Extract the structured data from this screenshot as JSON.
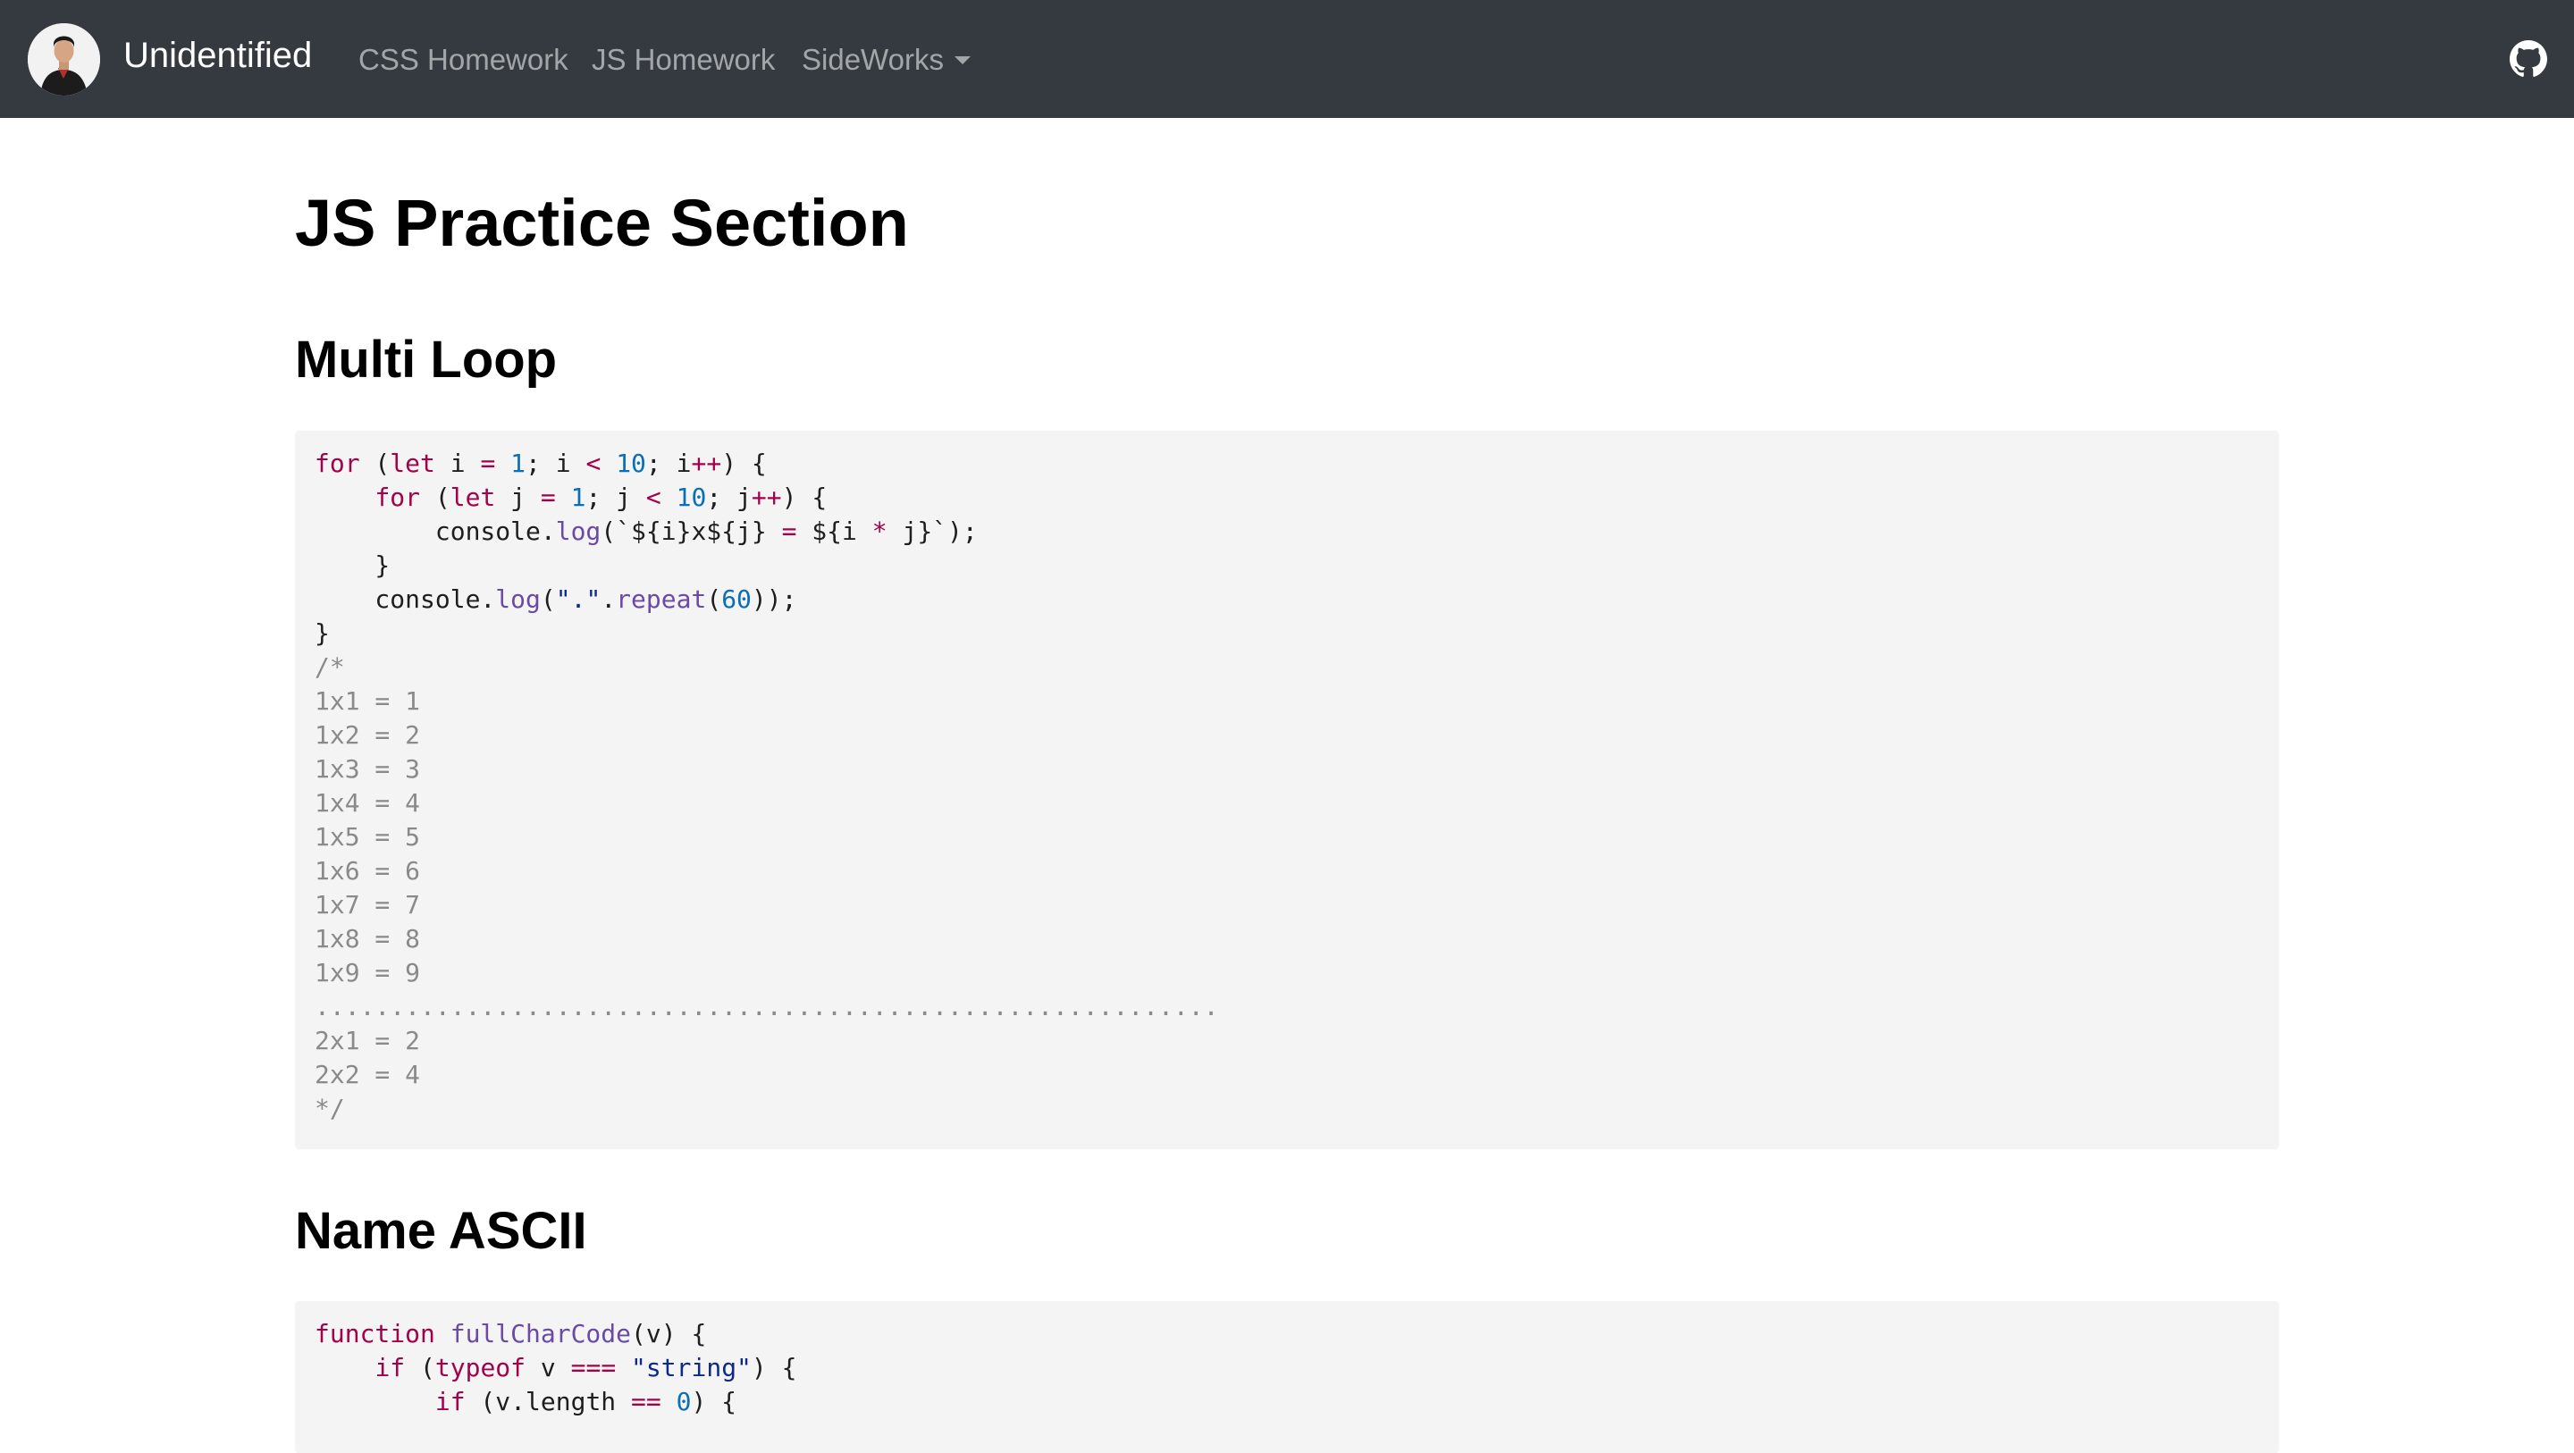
{
  "navbar": {
    "brand": "Unidentified",
    "links": [
      {
        "label": "CSS Homework"
      },
      {
        "label": "JS Homework"
      },
      {
        "label": "SideWorks"
      }
    ],
    "github_icon": "github-icon"
  },
  "main": {
    "page_title": "JS Practice Section",
    "sections": [
      {
        "title": "Multi Loop",
        "code_lines": [
          "for (let i = 1; i < 10; i++) {",
          "    for (let j = 1; j < 10; j++) {",
          "        console.log(`${i}x${j} = ${i * j}`);",
          "    }",
          "    console.log(\".\".repeat(60));",
          "}",
          "/*",
          "1x1 = 1",
          "1x2 = 2",
          "1x3 = 3",
          "1x4 = 4",
          "1x5 = 5",
          "1x6 = 6",
          "1x7 = 7",
          "1x8 = 8",
          "1x9 = 9",
          "............................................................",
          "2x1 = 2",
          "2x2 = 4",
          "*/"
        ]
      },
      {
        "title": "Name ASCII",
        "code_lines": [
          "function fullCharCode(v) {",
          "    if (typeof v === \"string\") {",
          "        if (v.length == 0) {"
        ]
      }
    ]
  },
  "colors": {
    "navbar_bg": "#343a40",
    "code_bg": "#f4f4f4",
    "keyword": "#a2024a",
    "number": "#0a6fb5",
    "function": "#6a4aa5",
    "string": "#0c2a8c",
    "comment": "#8a8a8a"
  }
}
